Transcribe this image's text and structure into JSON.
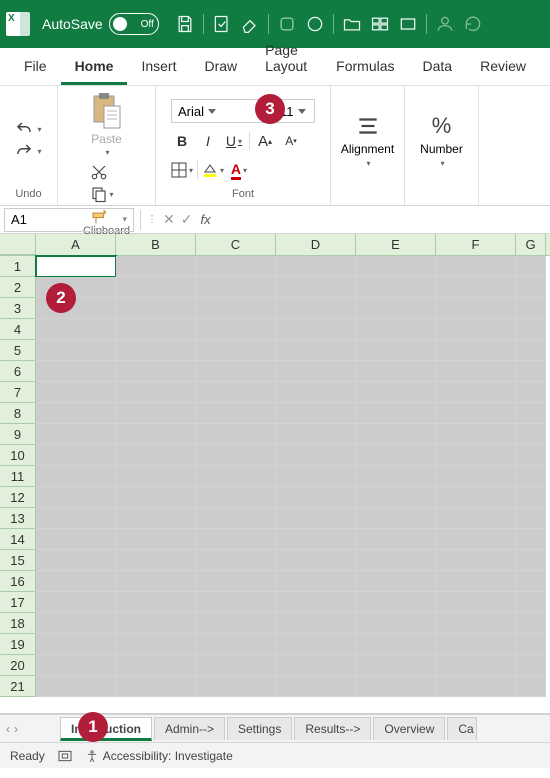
{
  "titlebar": {
    "autosave_label": "AutoSave",
    "autosave_state": "Off"
  },
  "tabs": [
    "File",
    "Home",
    "Insert",
    "Draw",
    "Page Layout",
    "Formulas",
    "Data",
    "Review"
  ],
  "active_tab": "Home",
  "ribbon": {
    "undo_label": "Undo",
    "clipboard_label": "Clipboard",
    "paste_label": "Paste",
    "font_label": "Font",
    "font_name": "Arial",
    "font_size": "11",
    "bold": "B",
    "italic": "I",
    "underline": "U",
    "alignment_label": "Alignment",
    "number_label": "Number"
  },
  "namebox": "A1",
  "fx": "fx",
  "columns": [
    "A",
    "B",
    "C",
    "D",
    "E",
    "F",
    "G"
  ],
  "rows": [
    "1",
    "2",
    "3",
    "4",
    "5",
    "6",
    "7",
    "8",
    "9",
    "10",
    "11",
    "12",
    "13",
    "14",
    "15",
    "16",
    "17",
    "18",
    "19",
    "20",
    "21"
  ],
  "active_cell": "A1",
  "sheets": [
    "Introduction",
    "Admin-->",
    "Settings",
    "Results-->",
    "Overview",
    "Ca"
  ],
  "active_sheet": "Introduction",
  "status": {
    "ready": "Ready",
    "accessibility": "Accessibility: Investigate"
  },
  "markers": {
    "m1": "1",
    "m2": "2",
    "m3": "3"
  }
}
